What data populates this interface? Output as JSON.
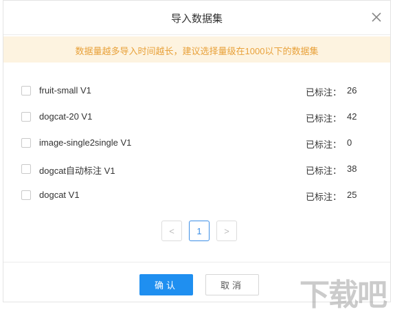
{
  "dialog": {
    "title": "导入数据集",
    "notice": "数据量越多导入时间越长，建议选择量级在1000以下的数据集",
    "annotated_label": "已标注：",
    "datasets": [
      {
        "name": "fruit-small V1",
        "count": "26"
      },
      {
        "name": "dogcat-20 V1",
        "count": "42"
      },
      {
        "name": "image-single2single V1",
        "count": "0"
      },
      {
        "name": "dogcat自动标注 V1",
        "count": "38"
      },
      {
        "name": "dogcat V1",
        "count": "25"
      }
    ],
    "pagination": {
      "prev": "<",
      "current": "1",
      "next": ">"
    },
    "confirm_label": "确认",
    "cancel_label": "取消"
  },
  "watermark": "下载吧",
  "colors": {
    "accent": "#1f8ff0",
    "notice_bg": "#fdf3e0",
    "notice_text": "#e8a13a"
  }
}
